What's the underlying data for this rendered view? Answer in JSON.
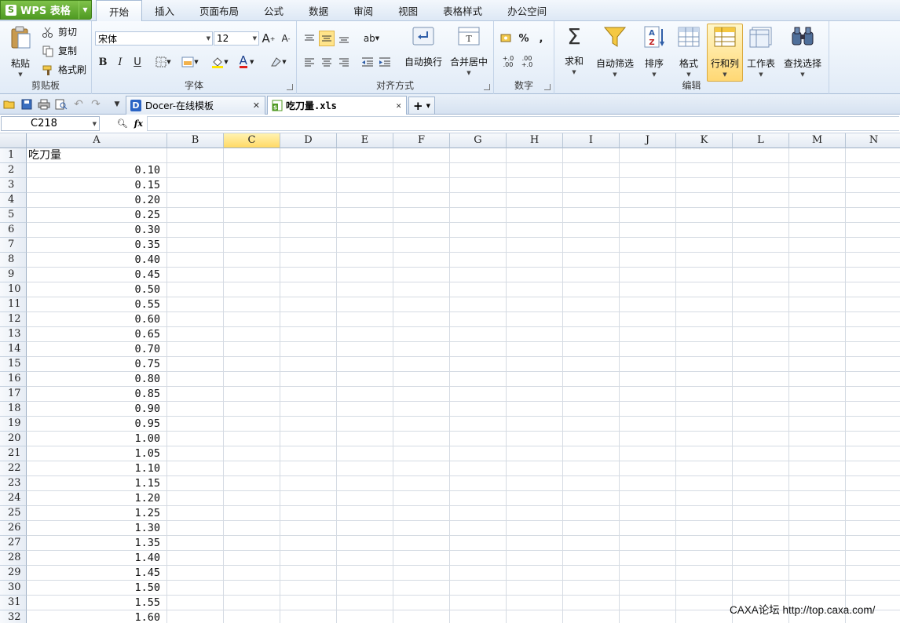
{
  "app": {
    "name": "WPS 表格",
    "logo_letter": "S"
  },
  "menu": {
    "tabs": [
      "开始",
      "插入",
      "页面布局",
      "公式",
      "数据",
      "审阅",
      "视图",
      "表格样式",
      "办公空间"
    ],
    "active": 0
  },
  "ribbon": {
    "clipboard": {
      "label": "剪贴板",
      "paste": "粘贴",
      "cut": "剪切",
      "copy": "复制",
      "format_painter": "格式刷"
    },
    "font": {
      "label": "字体",
      "font_name": "宋体",
      "font_size": "12",
      "bold": "B",
      "italic": "I",
      "underline": "U",
      "grow": "A",
      "shrink": "A",
      "font_color_letter": "A"
    },
    "alignment": {
      "label": "对齐方式",
      "wrap": "自动换行",
      "merge": "合并居中"
    },
    "number": {
      "label": "数字",
      "percent": "%",
      "comma": ",",
      "inc_decimal": "+.0 .00",
      "dec_decimal": ".00 +.0"
    },
    "editing": {
      "label": "编辑",
      "sum": "求和",
      "autofilter": "自动筛选",
      "sort": "排序",
      "format": "格式",
      "rows_cols": "行和列",
      "worksheet": "工作表",
      "find_select": "查找选择"
    }
  },
  "tabs": [
    {
      "label": "Docer-在线模板",
      "icon_letter": "D"
    },
    {
      "label": "吃刀量.xls",
      "active": true
    }
  ],
  "formula_bar": {
    "name_box": "C218",
    "fx": "fx",
    "value": ""
  },
  "columns": [
    "A",
    "B",
    "C",
    "D",
    "E",
    "F",
    "G",
    "H",
    "I",
    "J",
    "K",
    "L",
    "M",
    "N"
  ],
  "selected_column": "C",
  "rows": [
    "1",
    "2",
    "3",
    "4",
    "5",
    "6",
    "7",
    "8",
    "9",
    "10",
    "11",
    "12",
    "13",
    "14",
    "15",
    "16",
    "17",
    "18",
    "19",
    "20",
    "21",
    "22",
    "23",
    "24",
    "25",
    "26",
    "27",
    "28",
    "29",
    "30",
    "31",
    "32"
  ],
  "column_a": [
    "吃刀量",
    "0.10",
    "0.15",
    "0.20",
    "0.25",
    "0.30",
    "0.35",
    "0.40",
    "0.45",
    "0.50",
    "0.55",
    "0.60",
    "0.65",
    "0.70",
    "0.75",
    "0.80",
    "0.85",
    "0.90",
    "0.95",
    "1.00",
    "1.05",
    "1.10",
    "1.15",
    "1.20",
    "1.25",
    "1.30",
    "1.35",
    "1.40",
    "1.45",
    "1.50",
    "1.55",
    "1.60"
  ],
  "watermark": "CAXA论坛 http://top.caxa.com/"
}
